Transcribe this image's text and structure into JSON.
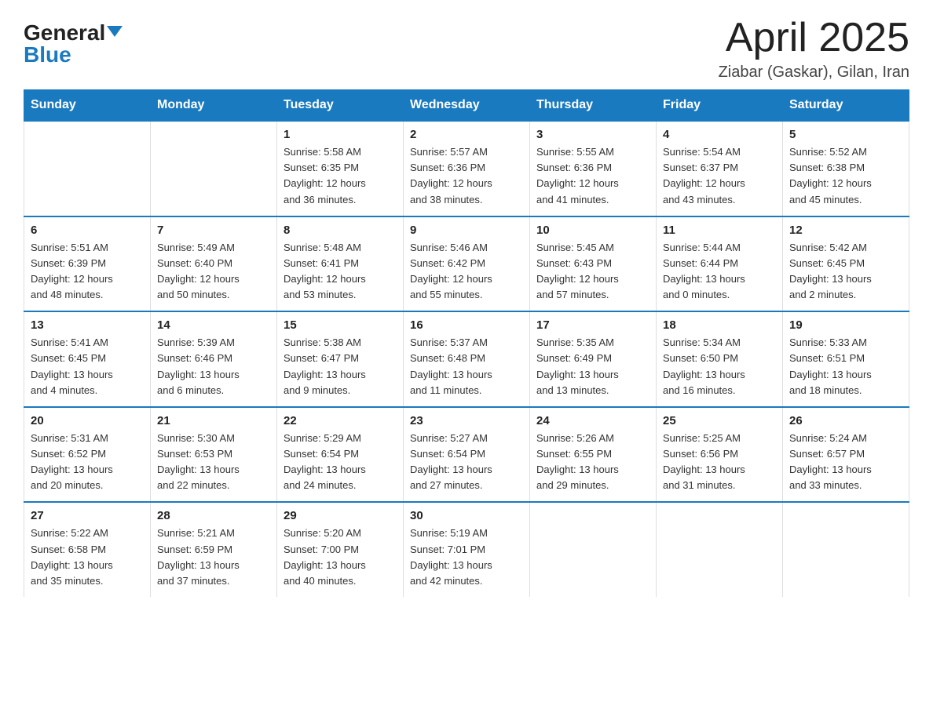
{
  "logo": {
    "general": "General",
    "blue": "Blue",
    "triangle": "▲"
  },
  "title": "April 2025",
  "subtitle": "Ziabar (Gaskar), Gilan, Iran",
  "days_of_week": [
    "Sunday",
    "Monday",
    "Tuesday",
    "Wednesday",
    "Thursday",
    "Friday",
    "Saturday"
  ],
  "weeks": [
    [
      {
        "day": "",
        "info": ""
      },
      {
        "day": "",
        "info": ""
      },
      {
        "day": "1",
        "info": "Sunrise: 5:58 AM\nSunset: 6:35 PM\nDaylight: 12 hours\nand 36 minutes."
      },
      {
        "day": "2",
        "info": "Sunrise: 5:57 AM\nSunset: 6:36 PM\nDaylight: 12 hours\nand 38 minutes."
      },
      {
        "day": "3",
        "info": "Sunrise: 5:55 AM\nSunset: 6:36 PM\nDaylight: 12 hours\nand 41 minutes."
      },
      {
        "day": "4",
        "info": "Sunrise: 5:54 AM\nSunset: 6:37 PM\nDaylight: 12 hours\nand 43 minutes."
      },
      {
        "day": "5",
        "info": "Sunrise: 5:52 AM\nSunset: 6:38 PM\nDaylight: 12 hours\nand 45 minutes."
      }
    ],
    [
      {
        "day": "6",
        "info": "Sunrise: 5:51 AM\nSunset: 6:39 PM\nDaylight: 12 hours\nand 48 minutes."
      },
      {
        "day": "7",
        "info": "Sunrise: 5:49 AM\nSunset: 6:40 PM\nDaylight: 12 hours\nand 50 minutes."
      },
      {
        "day": "8",
        "info": "Sunrise: 5:48 AM\nSunset: 6:41 PM\nDaylight: 12 hours\nand 53 minutes."
      },
      {
        "day": "9",
        "info": "Sunrise: 5:46 AM\nSunset: 6:42 PM\nDaylight: 12 hours\nand 55 minutes."
      },
      {
        "day": "10",
        "info": "Sunrise: 5:45 AM\nSunset: 6:43 PM\nDaylight: 12 hours\nand 57 minutes."
      },
      {
        "day": "11",
        "info": "Sunrise: 5:44 AM\nSunset: 6:44 PM\nDaylight: 13 hours\nand 0 minutes."
      },
      {
        "day": "12",
        "info": "Sunrise: 5:42 AM\nSunset: 6:45 PM\nDaylight: 13 hours\nand 2 minutes."
      }
    ],
    [
      {
        "day": "13",
        "info": "Sunrise: 5:41 AM\nSunset: 6:45 PM\nDaylight: 13 hours\nand 4 minutes."
      },
      {
        "day": "14",
        "info": "Sunrise: 5:39 AM\nSunset: 6:46 PM\nDaylight: 13 hours\nand 6 minutes."
      },
      {
        "day": "15",
        "info": "Sunrise: 5:38 AM\nSunset: 6:47 PM\nDaylight: 13 hours\nand 9 minutes."
      },
      {
        "day": "16",
        "info": "Sunrise: 5:37 AM\nSunset: 6:48 PM\nDaylight: 13 hours\nand 11 minutes."
      },
      {
        "day": "17",
        "info": "Sunrise: 5:35 AM\nSunset: 6:49 PM\nDaylight: 13 hours\nand 13 minutes."
      },
      {
        "day": "18",
        "info": "Sunrise: 5:34 AM\nSunset: 6:50 PM\nDaylight: 13 hours\nand 16 minutes."
      },
      {
        "day": "19",
        "info": "Sunrise: 5:33 AM\nSunset: 6:51 PM\nDaylight: 13 hours\nand 18 minutes."
      }
    ],
    [
      {
        "day": "20",
        "info": "Sunrise: 5:31 AM\nSunset: 6:52 PM\nDaylight: 13 hours\nand 20 minutes."
      },
      {
        "day": "21",
        "info": "Sunrise: 5:30 AM\nSunset: 6:53 PM\nDaylight: 13 hours\nand 22 minutes."
      },
      {
        "day": "22",
        "info": "Sunrise: 5:29 AM\nSunset: 6:54 PM\nDaylight: 13 hours\nand 24 minutes."
      },
      {
        "day": "23",
        "info": "Sunrise: 5:27 AM\nSunset: 6:54 PM\nDaylight: 13 hours\nand 27 minutes."
      },
      {
        "day": "24",
        "info": "Sunrise: 5:26 AM\nSunset: 6:55 PM\nDaylight: 13 hours\nand 29 minutes."
      },
      {
        "day": "25",
        "info": "Sunrise: 5:25 AM\nSunset: 6:56 PM\nDaylight: 13 hours\nand 31 minutes."
      },
      {
        "day": "26",
        "info": "Sunrise: 5:24 AM\nSunset: 6:57 PM\nDaylight: 13 hours\nand 33 minutes."
      }
    ],
    [
      {
        "day": "27",
        "info": "Sunrise: 5:22 AM\nSunset: 6:58 PM\nDaylight: 13 hours\nand 35 minutes."
      },
      {
        "day": "28",
        "info": "Sunrise: 5:21 AM\nSunset: 6:59 PM\nDaylight: 13 hours\nand 37 minutes."
      },
      {
        "day": "29",
        "info": "Sunrise: 5:20 AM\nSunset: 7:00 PM\nDaylight: 13 hours\nand 40 minutes."
      },
      {
        "day": "30",
        "info": "Sunrise: 5:19 AM\nSunset: 7:01 PM\nDaylight: 13 hours\nand 42 minutes."
      },
      {
        "day": "",
        "info": ""
      },
      {
        "day": "",
        "info": ""
      },
      {
        "day": "",
        "info": ""
      }
    ]
  ]
}
